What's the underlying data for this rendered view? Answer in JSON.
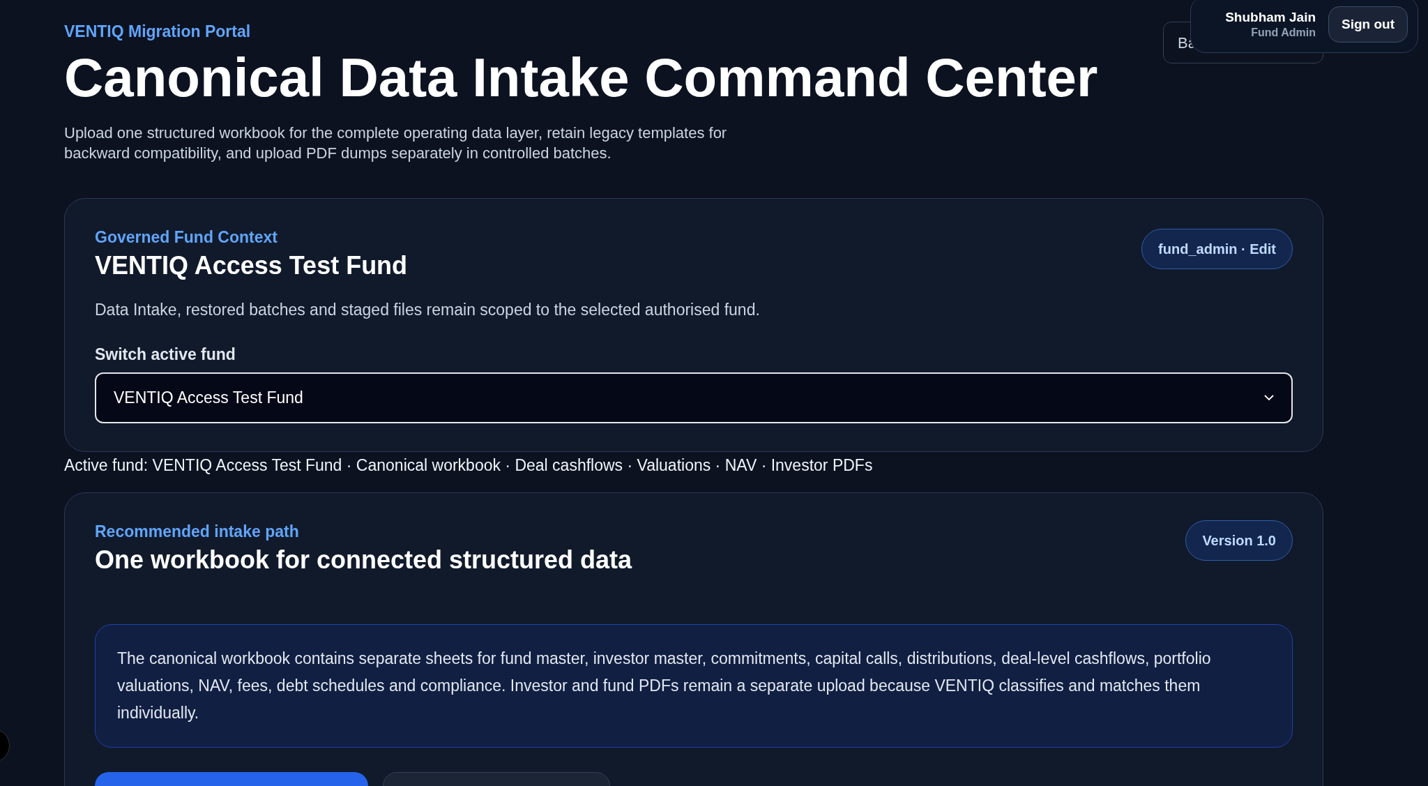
{
  "header": {
    "eyebrow": "VENTIQ Migration Portal",
    "title": "Canonical Data Intake Command Center",
    "description": "Upload one structured workbook for the complete operating data layer, retain legacy templates for backward compatibility, and upload PDF dumps separately in controlled batches.",
    "back_button": "Ba"
  },
  "user": {
    "name": "Shubham Jain",
    "role": "Fund Admin",
    "sign_out": "Sign out"
  },
  "fund_context": {
    "eyebrow": "Governed Fund Context",
    "title": "VENTIQ Access Test Fund",
    "badge": "fund_admin · Edit",
    "description": "Data Intake, restored batches and staged files remain scoped to the selected authorised fund.",
    "select_label": "Switch active fund",
    "select_value": "VENTIQ Access Test Fund"
  },
  "active_summary": "Active fund: VENTIQ Access Test Fund · Canonical workbook · Deal cashflows · Valuations · NAV · Investor PDFs",
  "intake": {
    "eyebrow": "Recommended intake path",
    "title": "One workbook for connected structured data",
    "badge": "Version 1.0",
    "note": "The canonical workbook contains separate sheets for fund master, investor master, commitments, capital calls, distributions, deal-level cashflows, portfolio valuations, NAV, fees, debt schedules and compliance. Investor and fund PDFs remain a separate upload because VENTIQ classifies and matches them individually.",
    "actions": [
      {
        "kind": "primary"
      },
      {
        "kind": "secondary"
      }
    ]
  }
}
